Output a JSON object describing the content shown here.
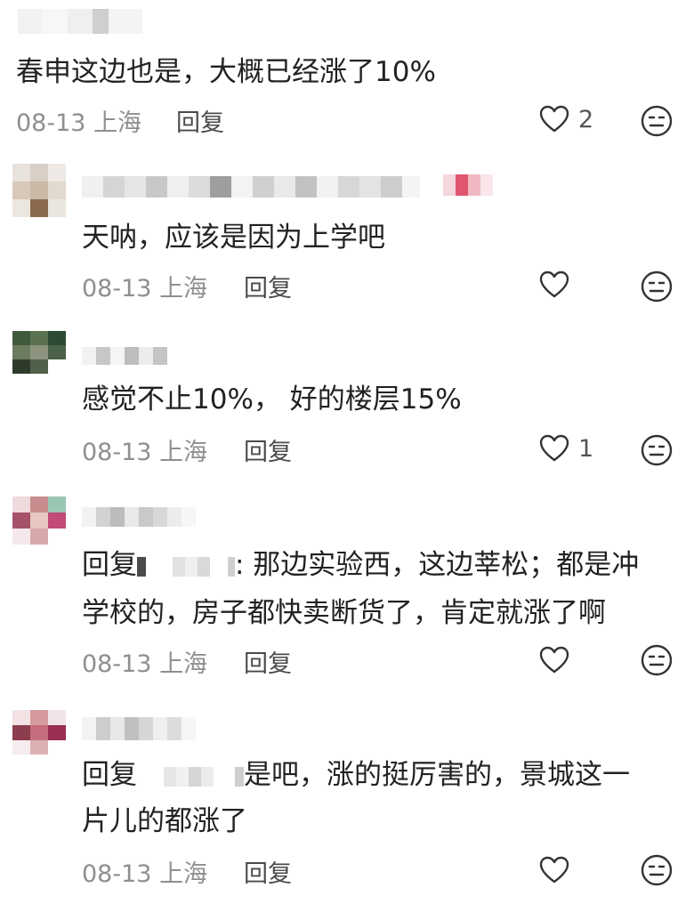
{
  "comments": [
    {
      "text": "春申这边也是，大概已经涨了10%",
      "date": "08-13",
      "location": "上海",
      "reply_label": "回复",
      "likes": "2"
    },
    {
      "text": "天呐，应该是因为上学吧",
      "date": "08-13",
      "location": "上海",
      "reply_label": "回复",
      "likes": ""
    },
    {
      "text": "感觉不止10%， 好的楼层15%",
      "date": "08-13",
      "location": "上海",
      "reply_label": "回复",
      "likes": "1"
    },
    {
      "reply_prefix": "回复",
      "text_line1": ": 那边实验西，这边莘松；都是冲",
      "text_line2": "学校的，房子都快卖断货了，肯定就涨了啊",
      "date": "08-13",
      "location": "上海",
      "reply_label": "回复",
      "likes": ""
    },
    {
      "reply_prefix": "回复",
      "text_line1": "是吧，涨的挺厉害的，景城这一",
      "text_line2": "片儿的都涨了",
      "date": "08-13",
      "location": "上海",
      "reply_label": "回复",
      "likes": ""
    }
  ],
  "icons": {
    "like": "heart-outline-icon",
    "dislike": "neutral-face-icon"
  },
  "colors": {
    "text": "#222222",
    "meta": "#8f8f8f",
    "icon": "#333333"
  }
}
